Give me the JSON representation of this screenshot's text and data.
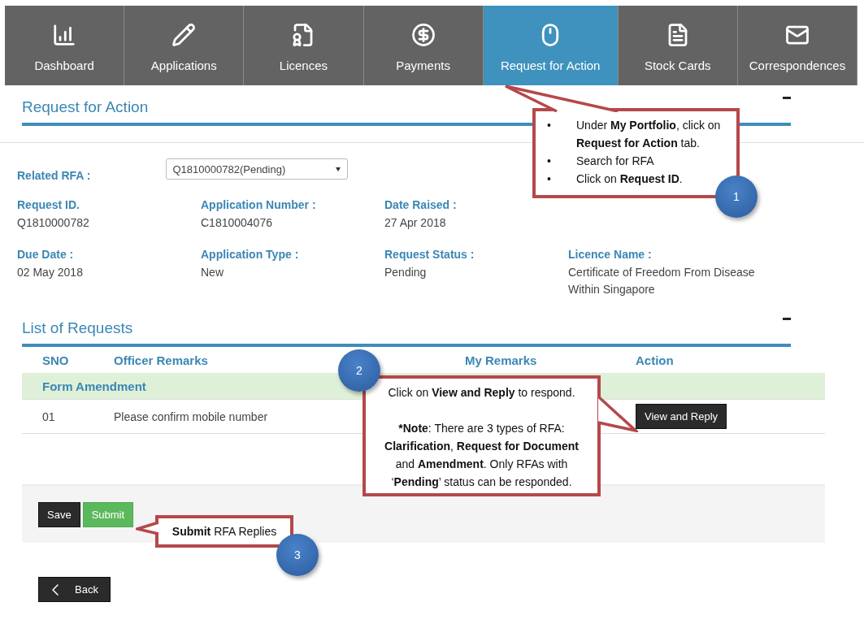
{
  "nav": {
    "tabs": [
      {
        "label": "Dashboard",
        "selected": false
      },
      {
        "label": "Applications",
        "selected": false
      },
      {
        "label": "Licences",
        "selected": false
      },
      {
        "label": "Payments",
        "selected": false
      },
      {
        "label": "Request for Action",
        "selected": true
      },
      {
        "label": "Stock Cards",
        "selected": false
      },
      {
        "label": "Correspondences",
        "selected": false
      }
    ]
  },
  "request_section": {
    "title": "Request for Action",
    "related_rfa": {
      "label": "Related RFA :",
      "value": "Q1810000782(Pending)"
    },
    "details": [
      [
        {
          "label": "Request ID.",
          "value": "Q1810000782"
        },
        {
          "label": "Application Number :",
          "value": "C1810004076"
        },
        {
          "label": "Date Raised :",
          "value": "27 Apr 2018"
        }
      ],
      [
        {
          "label": "Due Date :",
          "value": "02 May 2018"
        },
        {
          "label": "Application Type :",
          "value": "New"
        },
        {
          "label": "Request Status :",
          "value": "Pending"
        },
        {
          "label": "Licence Name :",
          "value": "Certificate of Freedom From Disease Within Singapore"
        }
      ]
    ]
  },
  "list_section": {
    "title": "List of Requests",
    "columns": [
      "SNO",
      "Officer Remarks",
      "My Remarks",
      "Action"
    ],
    "group": "Form Amendment",
    "rows": [
      {
        "sno": "01",
        "officer_remarks": "Please confirm mobile number",
        "action": "View and Reply"
      }
    ]
  },
  "form_buttons": [
    {
      "label": "Save",
      "kind": "dark"
    },
    {
      "label": "Submit",
      "kind": "green"
    }
  ],
  "back_button": "Back",
  "callouts": [
    {
      "kind": "bullets",
      "badge": "1",
      "marker": "•",
      "items": [
        "Under **My Portfolio**, click on **Request for Action** tab.",
        "Search for RFA",
        "Click on **Request ID**."
      ]
    },
    {
      "kind": "paragraphs",
      "badge": "2",
      "items": [
        "Click on **View and Reply** to respond.",
        "***Note**: There are 3 types of RFA: **Clarification**, **Request for Document** and **Amendment**. Only RFAs with ‘**Pending**’ status can be responded."
      ]
    },
    {
      "kind": "paragraphs",
      "badge": "3",
      "items": [
        "**Submit** RFA Replies"
      ]
    }
  ]
}
